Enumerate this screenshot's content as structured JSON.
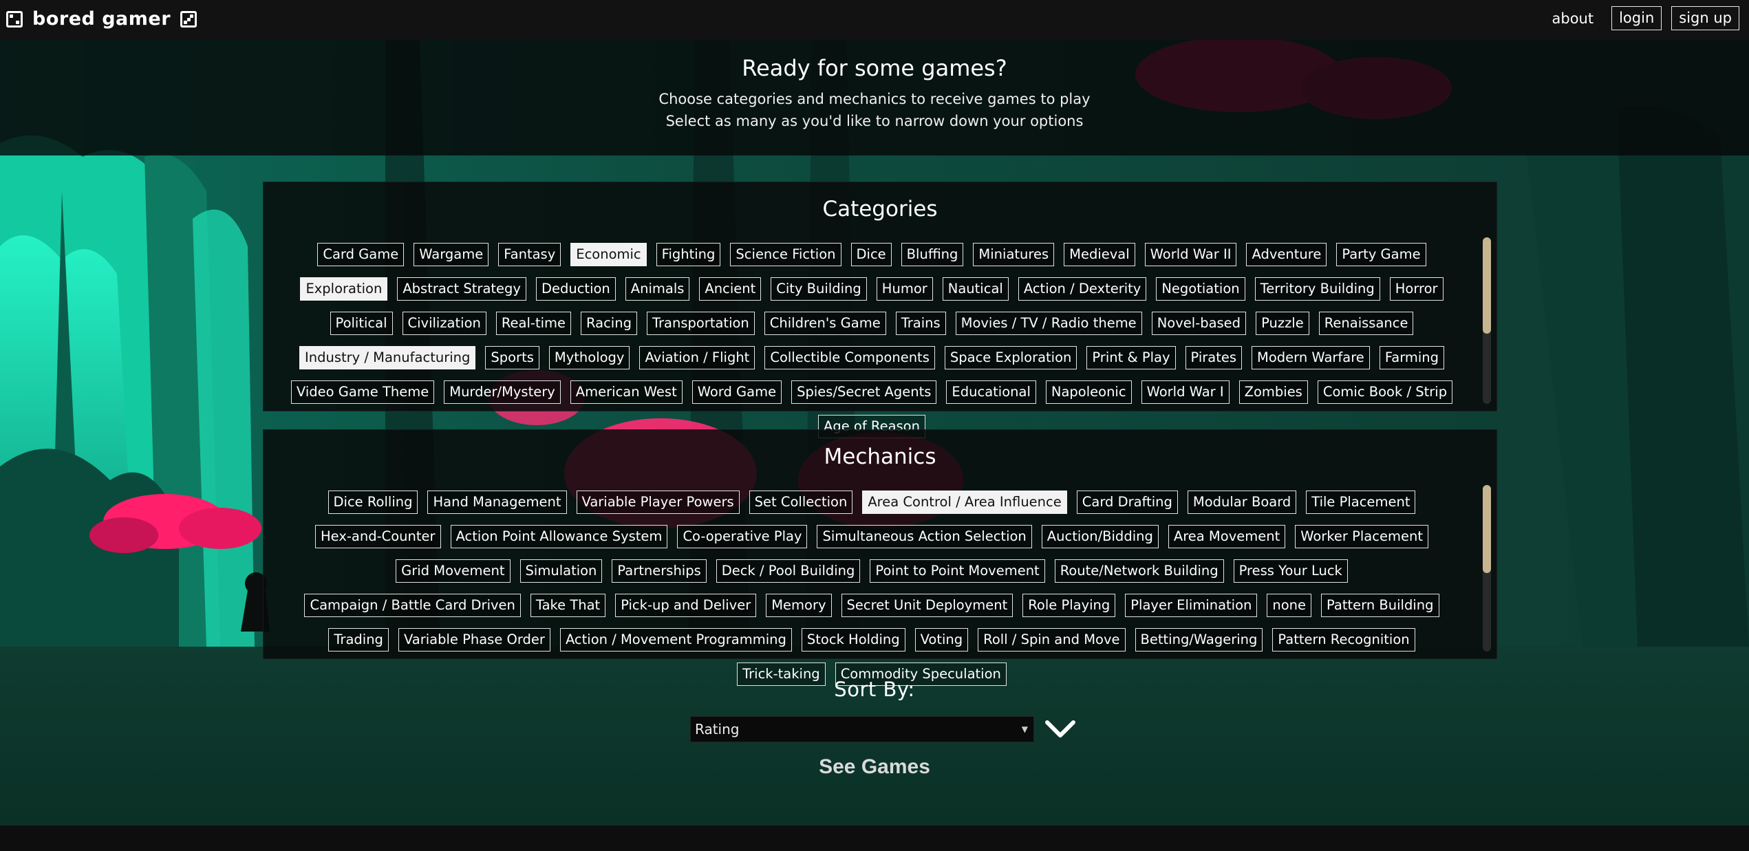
{
  "nav": {
    "brand": "bored gamer",
    "links": {
      "about": "about",
      "login": "login",
      "signup": "sign up"
    }
  },
  "hero": {
    "title": "Ready for some games?",
    "line1": "Choose categories and mechanics to receive games to play",
    "line2": "Select as many as you'd like to narrow down your options"
  },
  "categories": {
    "title": "Categories",
    "items": [
      {
        "label": "Card Game",
        "selected": false
      },
      {
        "label": "Wargame",
        "selected": false
      },
      {
        "label": "Fantasy",
        "selected": false
      },
      {
        "label": "Economic",
        "selected": true
      },
      {
        "label": "Fighting",
        "selected": false
      },
      {
        "label": "Science Fiction",
        "selected": false
      },
      {
        "label": "Dice",
        "selected": false
      },
      {
        "label": "Bluffing",
        "selected": false
      },
      {
        "label": "Miniatures",
        "selected": false
      },
      {
        "label": "Medieval",
        "selected": false
      },
      {
        "label": "World War II",
        "selected": false
      },
      {
        "label": "Adventure",
        "selected": false
      },
      {
        "label": "Party Game",
        "selected": false
      },
      {
        "label": "Exploration",
        "selected": true
      },
      {
        "label": "Abstract Strategy",
        "selected": false
      },
      {
        "label": "Deduction",
        "selected": false
      },
      {
        "label": "Animals",
        "selected": false
      },
      {
        "label": "Ancient",
        "selected": false
      },
      {
        "label": "City Building",
        "selected": false
      },
      {
        "label": "Humor",
        "selected": false
      },
      {
        "label": "Nautical",
        "selected": false
      },
      {
        "label": "Action / Dexterity",
        "selected": false
      },
      {
        "label": "Negotiation",
        "selected": false
      },
      {
        "label": "Territory Building",
        "selected": false
      },
      {
        "label": "Horror",
        "selected": false
      },
      {
        "label": "Political",
        "selected": false
      },
      {
        "label": "Civilization",
        "selected": false
      },
      {
        "label": "Real-time",
        "selected": false
      },
      {
        "label": "Racing",
        "selected": false
      },
      {
        "label": "Transportation",
        "selected": false
      },
      {
        "label": "Children's Game",
        "selected": false
      },
      {
        "label": "Trains",
        "selected": false
      },
      {
        "label": "Movies / TV / Radio theme",
        "selected": false
      },
      {
        "label": "Novel-based",
        "selected": false
      },
      {
        "label": "Puzzle",
        "selected": false
      },
      {
        "label": "Renaissance",
        "selected": false
      },
      {
        "label": "Industry / Manufacturing",
        "selected": true
      },
      {
        "label": "Sports",
        "selected": false
      },
      {
        "label": "Mythology",
        "selected": false
      },
      {
        "label": "Aviation / Flight",
        "selected": false
      },
      {
        "label": "Collectible Components",
        "selected": false
      },
      {
        "label": "Space Exploration",
        "selected": false
      },
      {
        "label": "Print & Play",
        "selected": false
      },
      {
        "label": "Pirates",
        "selected": false
      },
      {
        "label": "Modern Warfare",
        "selected": false
      },
      {
        "label": "Farming",
        "selected": false
      },
      {
        "label": "Video Game Theme",
        "selected": false
      },
      {
        "label": "Murder/Mystery",
        "selected": false
      },
      {
        "label": "American West",
        "selected": false
      },
      {
        "label": "Word Game",
        "selected": false
      },
      {
        "label": "Spies/Secret Agents",
        "selected": false
      },
      {
        "label": "Educational",
        "selected": false
      },
      {
        "label": "Napoleonic",
        "selected": false
      },
      {
        "label": "World War I",
        "selected": false
      },
      {
        "label": "Zombies",
        "selected": false
      },
      {
        "label": "Comic Book / Strip",
        "selected": false
      },
      {
        "label": "Age of Reason",
        "selected": false
      }
    ]
  },
  "mechanics": {
    "title": "Mechanics",
    "items": [
      {
        "label": "Dice Rolling",
        "selected": false
      },
      {
        "label": "Hand Management",
        "selected": false
      },
      {
        "label": "Variable Player Powers",
        "selected": false
      },
      {
        "label": "Set Collection",
        "selected": false
      },
      {
        "label": "Area Control / Area Influence",
        "selected": true
      },
      {
        "label": "Card Drafting",
        "selected": false
      },
      {
        "label": "Modular Board",
        "selected": false
      },
      {
        "label": "Tile Placement",
        "selected": false
      },
      {
        "label": "Hex-and-Counter",
        "selected": false
      },
      {
        "label": "Action Point Allowance System",
        "selected": false
      },
      {
        "label": "Co-operative Play",
        "selected": false
      },
      {
        "label": "Simultaneous Action Selection",
        "selected": false
      },
      {
        "label": "Auction/Bidding",
        "selected": false
      },
      {
        "label": "Area Movement",
        "selected": false
      },
      {
        "label": "Worker Placement",
        "selected": false
      },
      {
        "label": "Grid Movement",
        "selected": false
      },
      {
        "label": "Simulation",
        "selected": false
      },
      {
        "label": "Partnerships",
        "selected": false
      },
      {
        "label": "Deck / Pool Building",
        "selected": false
      },
      {
        "label": "Point to Point Movement",
        "selected": false
      },
      {
        "label": "Route/Network Building",
        "selected": false
      },
      {
        "label": "Press Your Luck",
        "selected": false
      },
      {
        "label": "Campaign / Battle Card Driven",
        "selected": false
      },
      {
        "label": "Take That",
        "selected": false
      },
      {
        "label": "Pick-up and Deliver",
        "selected": false
      },
      {
        "label": "Memory",
        "selected": false
      },
      {
        "label": "Secret Unit Deployment",
        "selected": false
      },
      {
        "label": "Role Playing",
        "selected": false
      },
      {
        "label": "Player Elimination",
        "selected": false
      },
      {
        "label": "none",
        "selected": false
      },
      {
        "label": "Pattern Building",
        "selected": false
      },
      {
        "label": "Trading",
        "selected": false
      },
      {
        "label": "Variable Phase Order",
        "selected": false
      },
      {
        "label": "Action / Movement Programming",
        "selected": false
      },
      {
        "label": "Stock Holding",
        "selected": false
      },
      {
        "label": "Voting",
        "selected": false
      },
      {
        "label": "Roll / Spin and Move",
        "selected": false
      },
      {
        "label": "Betting/Wagering",
        "selected": false
      },
      {
        "label": "Pattern Recognition",
        "selected": false
      },
      {
        "label": "Trick-taking",
        "selected": false
      },
      {
        "label": "Commodity Speculation",
        "selected": false
      }
    ]
  },
  "sort": {
    "label": "Sort By:",
    "selected": "Rating"
  },
  "actions": {
    "see_games": "See Games"
  },
  "colors": {
    "accent_teal": "#19e3b4",
    "accent_pink": "#ff1f6b",
    "scrollbar_thumb": "#c7b592",
    "nav_bg": "#121212"
  }
}
